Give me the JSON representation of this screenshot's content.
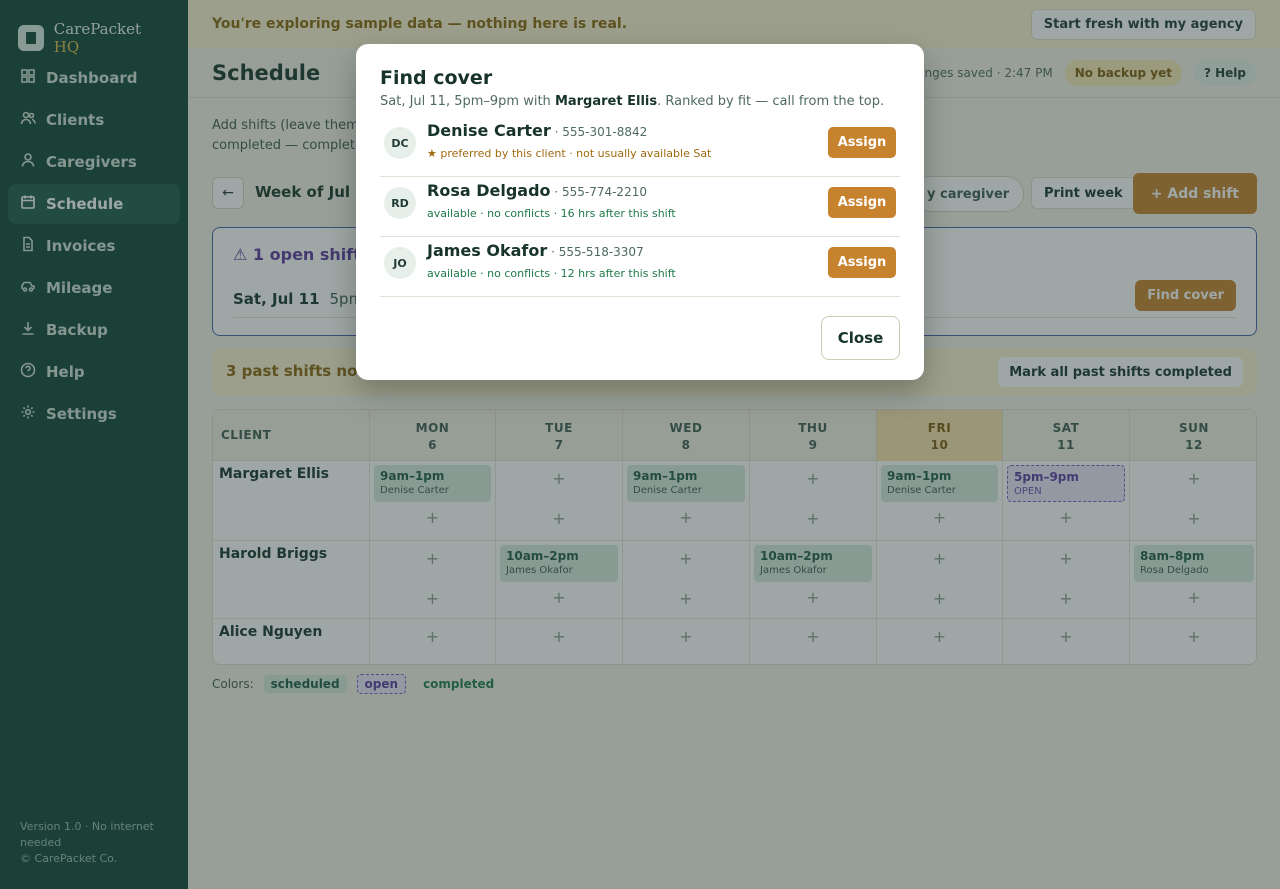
{
  "brand": {
    "name": "CarePacket",
    "suffix": "HQ"
  },
  "sidebar": {
    "items": [
      {
        "label": "Dashboard",
        "icon": "dashboard-icon"
      },
      {
        "label": "Clients",
        "icon": "users-icon"
      },
      {
        "label": "Caregivers",
        "icon": "user-icon"
      },
      {
        "label": "Schedule",
        "icon": "calendar-icon",
        "active": true
      },
      {
        "label": "Invoices",
        "icon": "document-icon"
      },
      {
        "label": "Mileage",
        "icon": "car-icon"
      },
      {
        "label": "Backup",
        "icon": "download-icon"
      },
      {
        "label": "Help",
        "icon": "help-icon"
      },
      {
        "label": "Settings",
        "icon": "gear-icon"
      }
    ],
    "footer_line1": "Version 1.0 · No internet needed",
    "footer_line2": "© CarePacket Co."
  },
  "banner": {
    "text": "You're exploring sample data — nothing here is real.",
    "button": "Start fresh with my agency"
  },
  "header": {
    "title": "Schedule",
    "saved": "hanges saved · 2:47 PM",
    "backup": "No backup yet",
    "help": "? Help"
  },
  "intro": {
    "line1": "Add shifts (leave them",
    "line2": "completed — complete"
  },
  "toolbar": {
    "back": "←",
    "week": "Week of Jul 6",
    "filter": "y caregiver",
    "print": "Print week",
    "add": "+ Add shift"
  },
  "open_shifts": {
    "title": "⚠ 1 open shift",
    "date": "Sat, Jul 11",
    "time": "5pm",
    "button": "Find cover"
  },
  "past": {
    "text": "3 past shifts not",
    "button": "Mark all past shifts completed"
  },
  "schedule": {
    "client_header": "CLIENT",
    "days": [
      {
        "name": "MON",
        "num": "6"
      },
      {
        "name": "TUE",
        "num": "7"
      },
      {
        "name": "WED",
        "num": "8"
      },
      {
        "name": "THU",
        "num": "9"
      },
      {
        "name": "FRI",
        "num": "10",
        "today": true
      },
      {
        "name": "SAT",
        "num": "11"
      },
      {
        "name": "SUN",
        "num": "12"
      }
    ],
    "rows": [
      {
        "client": "Margaret Ellis",
        "shifts": [
          {
            "time": "9am–1pm",
            "who": "Denise Carter"
          },
          null,
          {
            "time": "9am–1pm",
            "who": "Denise Carter"
          },
          null,
          {
            "time": "9am–1pm",
            "who": "Denise Carter"
          },
          {
            "time": "5pm–9pm",
            "who": "OPEN",
            "open": true
          },
          null
        ]
      },
      {
        "client": "Harold Briggs",
        "shifts": [
          null,
          {
            "time": "10am–2pm",
            "who": "James Okafor"
          },
          null,
          {
            "time": "10am–2pm",
            "who": "James Okafor"
          },
          null,
          null,
          {
            "time": "8am–8pm",
            "who": "Rosa Delgado"
          }
        ]
      },
      {
        "client": "Alice Nguyen",
        "shifts": [
          null,
          null,
          null,
          null,
          null,
          null,
          null
        ]
      }
    ],
    "plus": "+"
  },
  "legend": {
    "label": "Colors:",
    "scheduled": "scheduled",
    "open": "open",
    "completed": "completed"
  },
  "modal": {
    "title": "Find cover",
    "sub_pre": "Sat, Jul 11, 5pm–9pm with ",
    "sub_client": "Margaret Ellis",
    "sub_post": ". Ranked by fit — call from the top.",
    "candidates": [
      {
        "initials": "DC",
        "name": "Denise Carter",
        "phone": " · 555-301-8842",
        "note": "★ preferred by this client · not usually available Sat",
        "warn": true
      },
      {
        "initials": "RD",
        "name": "Rosa Delgado",
        "phone": " · 555-774-2210",
        "note": "available · no conflicts · 16 hrs after this shift",
        "warn": false
      },
      {
        "initials": "JO",
        "name": "James Okafor",
        "phone": " · 555-518-3307",
        "note": "available · no conflicts · 12 hrs after this shift",
        "warn": false
      }
    ],
    "assign": "Assign",
    "close": "Close"
  },
  "colors": {
    "sidebar": "#0f4438",
    "accent": "#c7822e",
    "open": "#5b3aa0",
    "banner": "#fbf0cf"
  }
}
